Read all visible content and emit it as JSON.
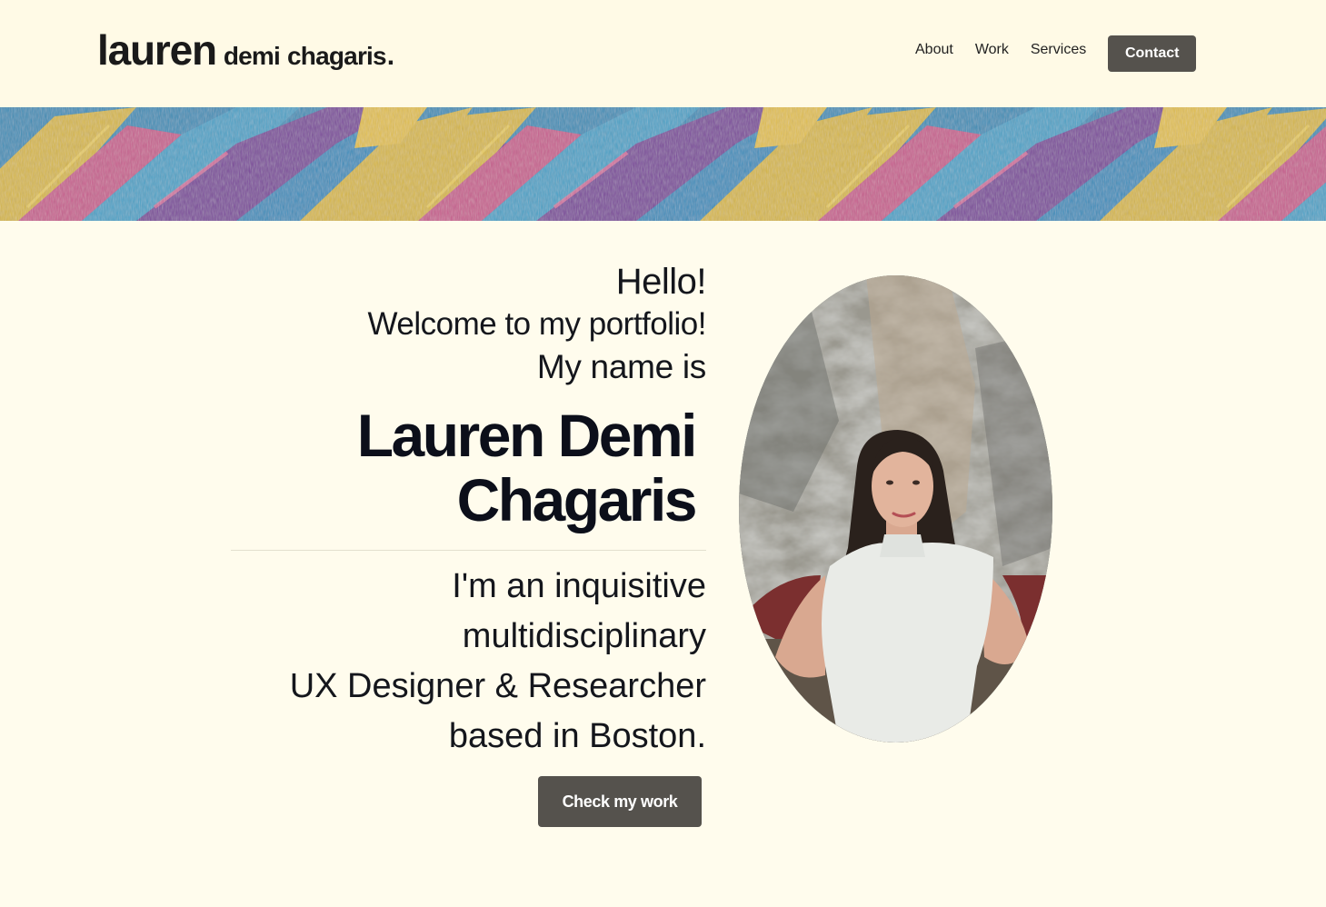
{
  "header": {
    "logo": {
      "first": "lauren",
      "middle": "demi",
      "last": "chagaris",
      "dot": "."
    },
    "nav": [
      {
        "label": "About"
      },
      {
        "label": "Work"
      },
      {
        "label": "Services"
      }
    ],
    "contact_label": "Contact"
  },
  "hero": {
    "greeting": "Hello!",
    "welcome": "Welcome to my portfolio!",
    "intro": "My name is",
    "name_line1": "Lauren Demi",
    "name_line2": "Chagaris",
    "bio_lines": [
      "I'm an inquisitive",
      "multidisciplinary",
      "UX Designer & Researcher",
      "based in Boston."
    ],
    "cta_label": "Check my work"
  },
  "colors": {
    "page_bg": "#fffced",
    "header_bg": "#fffae6",
    "button_bg": "#55524d",
    "text": "#14161c",
    "banner_blue": "#3d8fb8",
    "banner_yellow": "#d8b948",
    "banner_purple": "#7d4a9c",
    "banner_pink": "#d8628a"
  },
  "images": {
    "banner": "abstract-paint-strokes",
    "portrait": "woman-portrait-in-front-of-rocks"
  }
}
